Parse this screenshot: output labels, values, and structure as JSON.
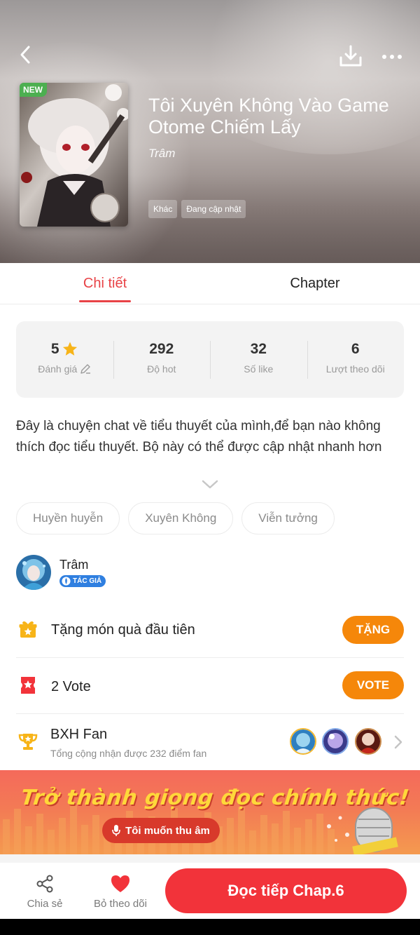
{
  "header": {
    "title": "Tôi Xuyên Không Vào Game Otome Chiếm Lấy",
    "author": "Trâm",
    "new_badge": "NEW",
    "genre_tags": [
      "Khác",
      "Đang cập nhật"
    ],
    "icons": [
      "back-arrow-icon",
      "download-icon",
      "more-icon"
    ]
  },
  "tabs": [
    {
      "label": "Chi tiết",
      "active": true
    },
    {
      "label": "Chapter",
      "active": false
    }
  ],
  "stats": [
    {
      "value": "5",
      "label": "Đánh giá",
      "icon": "star-icon"
    },
    {
      "value": "292",
      "label": "Độ hot"
    },
    {
      "value": "32",
      "label": "Số like"
    },
    {
      "value": "6",
      "label": "Lượt theo dõi"
    }
  ],
  "description": "Đây là chuyện chat về tiểu thuyết của mình,để bạn nào không thích đọc tiểu thuyết. Bộ này có thể được cập nhật nhanh hơn",
  "tags": [
    "Huyền huyễn",
    "Xuyên Không",
    "Viễn tưởng"
  ],
  "author_block": {
    "name": "Trâm",
    "badge": "TÁC GIẢ"
  },
  "gift": {
    "text": "Tặng món quà đầu tiên",
    "button": "TẶNG"
  },
  "vote": {
    "text": "2 Vote",
    "button": "VOTE"
  },
  "fan": {
    "title": "BXH Fan",
    "subtitle": "Tổng cộng nhận được 232 điểm fan"
  },
  "banner": {
    "title": "Trở thành giọng đọc chính thức!",
    "button": "Tôi muốn thu âm"
  },
  "bottom_bar": {
    "share": "Chia sẻ",
    "unfollow": "Bỏ theo dõi",
    "read": "Đọc tiếp Chap.6"
  },
  "colors": {
    "accent_red": "#e84347",
    "orange": "#f5870a",
    "read_button": "#f2333a",
    "badge_blue": "#2f7fe0"
  }
}
